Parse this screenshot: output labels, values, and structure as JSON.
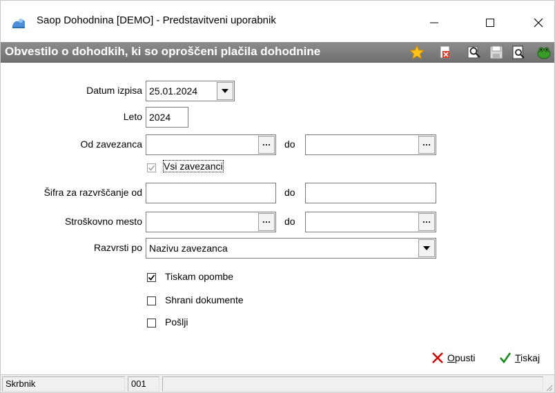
{
  "window": {
    "title": "Saop Dohodnina [DEMO] - Predstavitveni uporabnik"
  },
  "header": {
    "title": "Obvestilo o dohodkih, ki so oproščeni plačila dohodnine"
  },
  "toolbar": {
    "icons": [
      "star-icon",
      "delete-doc-icon",
      "search-icon",
      "save-icon",
      "print-preview-icon",
      "frog-icon"
    ]
  },
  "form": {
    "datum_izpisa": {
      "label": "Datum izpisa",
      "value": "25.01.2024"
    },
    "leto": {
      "label": "Leto",
      "value": "2024"
    },
    "od_zavezanca": {
      "label": "Od zavezanca",
      "value_from": "",
      "to_label": "do",
      "value_to": ""
    },
    "vsi_zavezanci": {
      "label": "Vsi zavezanci",
      "checked": true,
      "disabled": true
    },
    "sifra": {
      "label": "Šifra za razvrščanje od",
      "value_from": "",
      "to_label": "do",
      "value_to": ""
    },
    "strosk_mesto": {
      "label": "Stroškovno mesto",
      "value_from": "",
      "to_label": "do",
      "value_to": ""
    },
    "razvrsti_po": {
      "label": "Razvrsti po",
      "value": "Nazivu zavezanca"
    },
    "tiskam_opombe": {
      "label": "Tiskam opombe",
      "checked": true
    },
    "shrani_dokumente": {
      "label": "Shrani dokumente",
      "checked": false
    },
    "poslji": {
      "label": "Pošlji",
      "checked": false
    }
  },
  "actions": {
    "cancel_first": "O",
    "cancel_rest": "pusti",
    "print_first": "T",
    "print_rest": "iskaj"
  },
  "statusbar": {
    "user": "Skrbnik",
    "code": "001",
    "extra": ""
  },
  "colors": {
    "header_band": "#7a7a7a",
    "cancel_red": "#d00000",
    "ok_green": "#1a8a1a"
  }
}
